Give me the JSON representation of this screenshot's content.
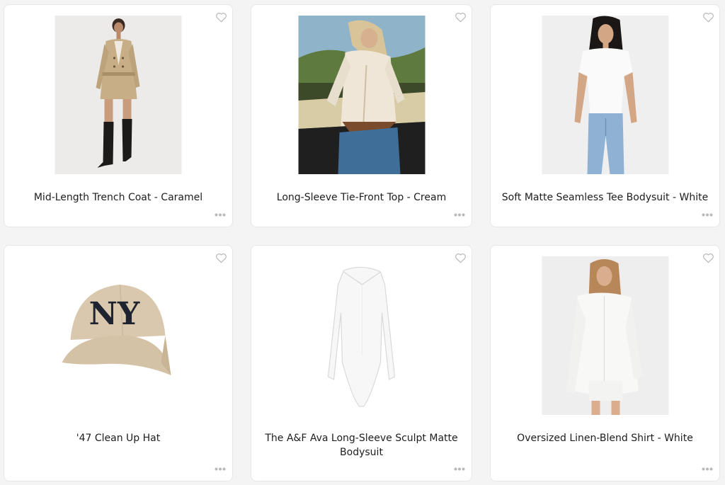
{
  "products": [
    {
      "title": "Mid-Length Trench Coat - Caramel",
      "favorite_icon": "heart-outline-icon",
      "more_icon": "ellipsis-icon"
    },
    {
      "title": "Long-Sleeve Tie-Front Top - Cream",
      "favorite_icon": "heart-outline-icon",
      "more_icon": "ellipsis-icon"
    },
    {
      "title": "Soft Matte Seamless Tee Bodysuit - White",
      "favorite_icon": "heart-outline-icon",
      "more_icon": "ellipsis-icon"
    },
    {
      "title": "'47 Clean Up Hat",
      "favorite_icon": "heart-outline-icon",
      "more_icon": "ellipsis-icon"
    },
    {
      "title": "The A&F Ava Long-Sleeve Sculpt Matte Bodysuit",
      "favorite_icon": "heart-outline-icon",
      "more_icon": "ellipsis-icon"
    },
    {
      "title": "Oversized Linen-Blend Shirt - White",
      "favorite_icon": "heart-outline-icon",
      "more_icon": "ellipsis-icon"
    }
  ],
  "colors": {
    "page_background": "#f4f4f4",
    "card_background": "#ffffff",
    "icon_gray": "#b9b9b9",
    "text": "#1d1d1d"
  }
}
